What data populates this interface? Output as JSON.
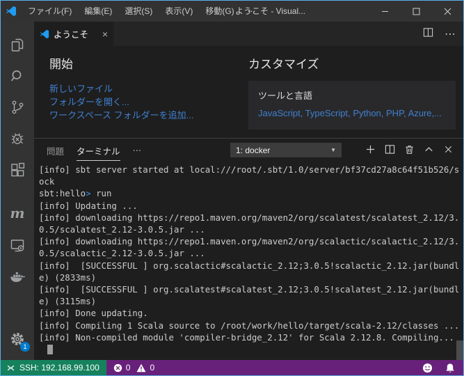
{
  "colors": {
    "accent": "#007acc",
    "window_border": "#5ab0e8",
    "titlebar_bg": "#323233",
    "activitybar_bg": "#333333",
    "tabbar_bg": "#252526",
    "editor_bg": "#1e1e1e",
    "card_bg": "#29292b",
    "link": "#4080d0",
    "remote_bg": "#16825d",
    "statusbar_bg": "#68217a"
  },
  "titlebar": {
    "app_title": "ようこそ - Visual...",
    "menus": [
      "ファイル(F)",
      "編集(E)",
      "選択(S)",
      "表示(V)",
      "移動(G)"
    ],
    "more_label": "⋯"
  },
  "activity_bar": {
    "icons": [
      "explorer",
      "search",
      "source-control",
      "debug",
      "extensions",
      "metals",
      "remote-explorer",
      "docker",
      "settings"
    ],
    "settings_badge": "1"
  },
  "editor": {
    "tab_label": "ようこそ",
    "tab_close": "×"
  },
  "welcome": {
    "start_title": "開始",
    "start_links": [
      "新しいファイル",
      "フォルダーを開く...",
      "ワークスペース フォルダーを追加..."
    ],
    "customize_title": "カスタマイズ",
    "tools_title": "ツールと言語",
    "tools_links": [
      "JavaScript",
      "TypeScript",
      "Python",
      "PHP",
      "Azure"
    ],
    "tools_links_suffix": ",..."
  },
  "panel": {
    "tab_problems": "問題",
    "tab_terminal": "ターミナル",
    "more_label": "⋯",
    "terminal_select": "1: docker",
    "select_arrow": "▼"
  },
  "terminal": {
    "prompt_arrow_color": "#3b8eea",
    "lines": [
      {
        "segments": [
          {
            "t": "[info] sbt server started at local:///root/.sbt/1.0/server/bf37cd27a8c64f51b526/s"
          }
        ]
      },
      {
        "segments": [
          {
            "t": "ock"
          }
        ]
      },
      {
        "segments": [
          {
            "t": "sbt:hello"
          },
          {
            "t": ">",
            "c": "#3b8eea"
          },
          {
            "t": " run"
          }
        ]
      },
      {
        "segments": [
          {
            "t": "[info] Updating ..."
          }
        ]
      },
      {
        "segments": [
          {
            "t": "[info] downloading https://repo1.maven.org/maven2/org/scalatest/scalatest_2.12/3."
          }
        ]
      },
      {
        "segments": [
          {
            "t": "0.5/scalatest_2.12-3.0.5.jar ..."
          }
        ]
      },
      {
        "segments": [
          {
            "t": "[info] downloading https://repo1.maven.org/maven2/org/scalactic/scalactic_2.12/3."
          }
        ]
      },
      {
        "segments": [
          {
            "t": "0.5/scalactic_2.12-3.0.5.jar ..."
          }
        ]
      },
      {
        "segments": [
          {
            "t": "[info]  [SUCCESSFUL ] org.scalactic#scalactic_2.12;3.0.5!scalactic_2.12.jar(bundl"
          }
        ]
      },
      {
        "segments": [
          {
            "t": "e) (2833ms)"
          }
        ]
      },
      {
        "segments": [
          {
            "t": "[info]  [SUCCESSFUL ] org.scalatest#scalatest_2.12;3.0.5!scalatest_2.12.jar(bundl"
          }
        ]
      },
      {
        "segments": [
          {
            "t": "e) (3115ms)"
          }
        ]
      },
      {
        "segments": [
          {
            "t": "[info] Done updating."
          }
        ]
      },
      {
        "segments": [
          {
            "t": "[info] Compiling 1 Scala source to /root/work/hello/target/scala-2.12/classes ..."
          }
        ]
      },
      {
        "segments": [
          {
            "t": "[info] Non-compiled module 'compiler-bridge_2.12' for Scala 2.12.8. Compiling..."
          }
        ]
      },
      {
        "segments": [],
        "cursor": true
      }
    ]
  },
  "statusbar": {
    "remote_label": "SSH: 192.168.99.100",
    "error_count": "0",
    "warning_count": "0"
  }
}
